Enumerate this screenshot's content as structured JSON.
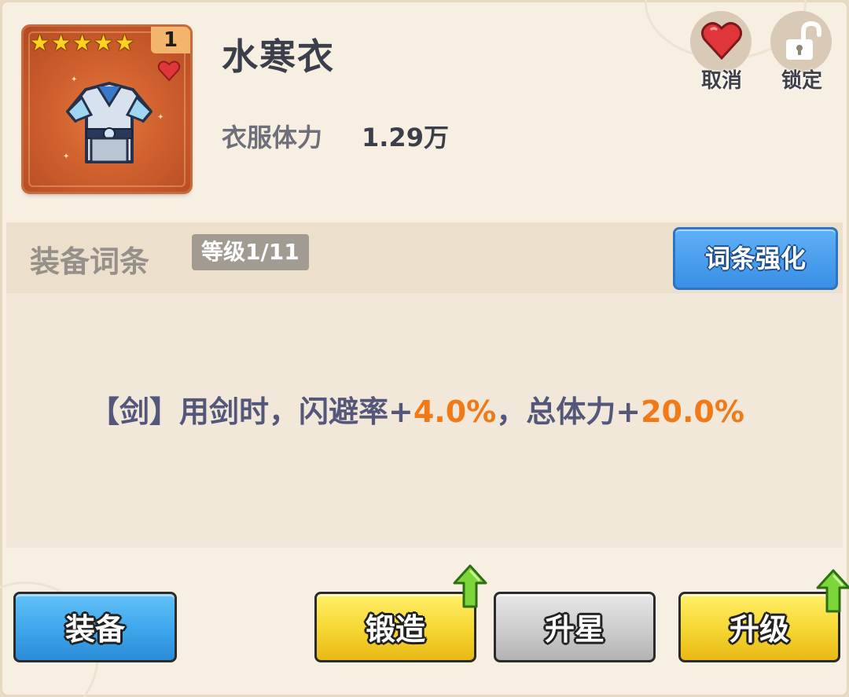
{
  "item": {
    "name": "水寒衣",
    "stars": 5,
    "count": "1",
    "stat_label": "衣服体力",
    "stat_value": "1.29万"
  },
  "actions": {
    "cancel_label": "取消",
    "lock_label": "锁定"
  },
  "affix": {
    "title": "装备词条",
    "level": "等级1/11",
    "enhance_label": "词条强化",
    "effect_prefix": "【剑】用剑时，闪避率+",
    "effect_value1": "4.0%",
    "effect_mid": "，总体力+",
    "effect_value2": "20.0%"
  },
  "buttons": {
    "equip": "装备",
    "forge": "锻造",
    "star_up": "升星",
    "level_up": "升级"
  },
  "colors": {
    "highlight": "#f07a17",
    "heart": "#e0363a",
    "card": "#d0602e"
  }
}
